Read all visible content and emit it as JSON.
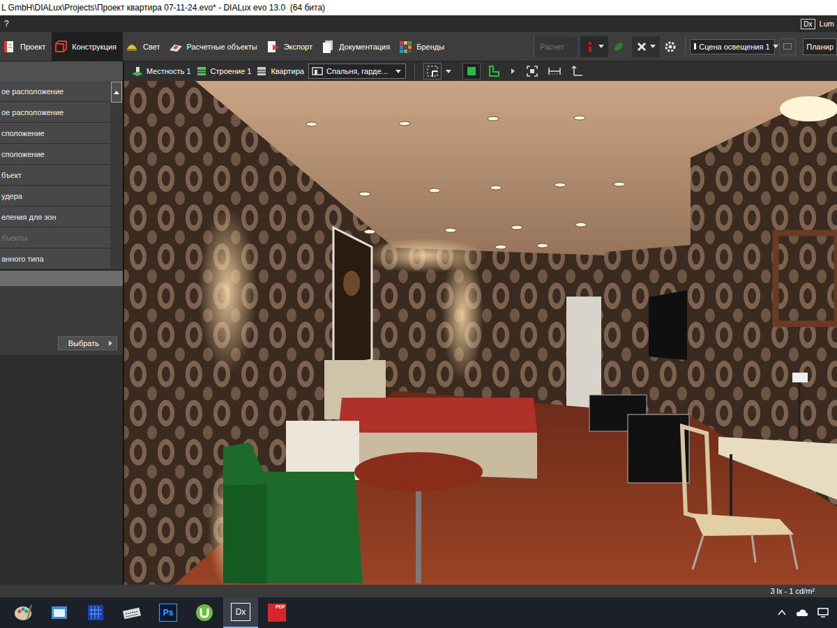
{
  "window": {
    "title": "L GmbH\\DIALux\\Projects\\Проект квартира 07-11-24.evo* - DIALux evo 13.0  (64 бита)",
    "help": "?",
    "badge": "Dx",
    "right_label": "Lum"
  },
  "tabs": [
    {
      "label": "Проект",
      "selected": false
    },
    {
      "label": "Конструкция",
      "selected": true
    },
    {
      "label": "Свет",
      "selected": false
    },
    {
      "label": "Расчетные объекты",
      "selected": false
    },
    {
      "label": "Экспорт",
      "selected": false
    },
    {
      "label": "Документация",
      "selected": false
    },
    {
      "label": "Бренды",
      "selected": false
    }
  ],
  "toolbar": {
    "calc": "Расчет",
    "calc_disabled": true,
    "scene": "Сцена освещения 1",
    "plan": "Планир"
  },
  "sidebar": {
    "items": [
      {
        "label": "ое расположение",
        "disabled": false
      },
      {
        "label": "ое расположение",
        "disabled": false
      },
      {
        "label": "сположение",
        "disabled": false
      },
      {
        "label": "сположение",
        "disabled": false
      },
      {
        "label": "бъект",
        "disabled": false
      },
      {
        "label": "удера",
        "disabled": false
      },
      {
        "label": "еления для зон",
        "disabled": false
      },
      {
        "label": "бъекты",
        "disabled": true
      },
      {
        "label": "анного типа",
        "disabled": false
      }
    ],
    "select_button": "Выбрать"
  },
  "breadcrumb": [
    {
      "label": "Местность 1"
    },
    {
      "label": "Строение 1"
    },
    {
      "label": "Квартира"
    }
  ],
  "room_select": "Спальня, гарде...",
  "status_bar": {
    "reading": "3 lx - 1 cd/m²"
  },
  "taskbar": [
    {
      "label": "",
      "selected": false
    },
    {
      "label": "",
      "selected": false
    },
    {
      "label": "",
      "selected": false
    },
    {
      "label": "",
      "selected": false
    },
    {
      "label": "Ps",
      "selected": false
    },
    {
      "label": "",
      "selected": false
    },
    {
      "label": "Dx",
      "selected": true
    },
    {
      "label": "PDF",
      "selected": false
    }
  ]
}
